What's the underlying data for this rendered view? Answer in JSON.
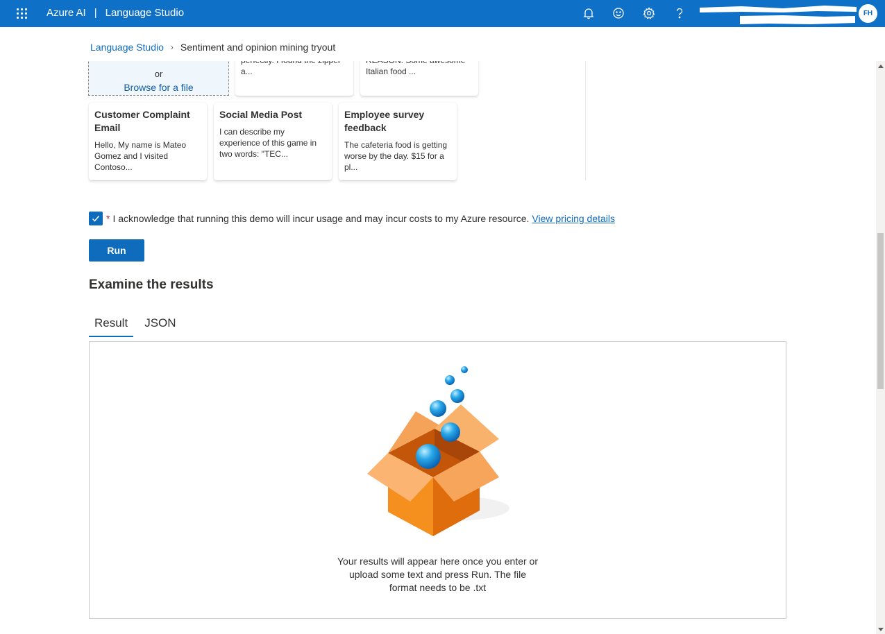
{
  "header": {
    "app_name": "Azure AI",
    "separator": "|",
    "product_name": "Language Studio",
    "icons": [
      "bell-icon",
      "feedback-smiley-icon",
      "settings-gear-icon",
      "help-icon"
    ],
    "avatar_initials": "FH",
    "bar_color": "#0f70c8"
  },
  "breadcrumb": {
    "root": "Language Studio",
    "current": "Sentiment and opinion mining tryout"
  },
  "upload": {
    "or_text": "or",
    "browse_label": "Browse for a file"
  },
  "sample_cards_top": [
    {
      "body": "perfectly. I found the zipper a..."
    },
    {
      "body": "REASON: Some awesome Italian food ..."
    }
  ],
  "sample_cards": [
    {
      "title": "Customer Complaint Email",
      "body": "Hello, My name is Mateo Gomez and I visited Contoso..."
    },
    {
      "title": "Social Media Post",
      "body": "I can describe my experience of this game in two words: \"TEC..."
    },
    {
      "title": "Employee survey feedback",
      "body": "The cafeteria food is getting worse by the day. $15 for a pl..."
    }
  ],
  "acknowledge": {
    "checked": true,
    "required_marker": "*",
    "text": "I acknowledge that running this demo will incur usage and may incur costs to my Azure resource.",
    "link": "View pricing details"
  },
  "run_label": "Run",
  "results": {
    "title": "Examine the results",
    "tabs": [
      {
        "label": "Result",
        "active": true
      },
      {
        "label": "JSON",
        "active": false
      }
    ],
    "empty_lines": [
      "Your results will appear here once you enter or",
      "upload some text and press Run. The file",
      "format needs to be .txt"
    ]
  }
}
